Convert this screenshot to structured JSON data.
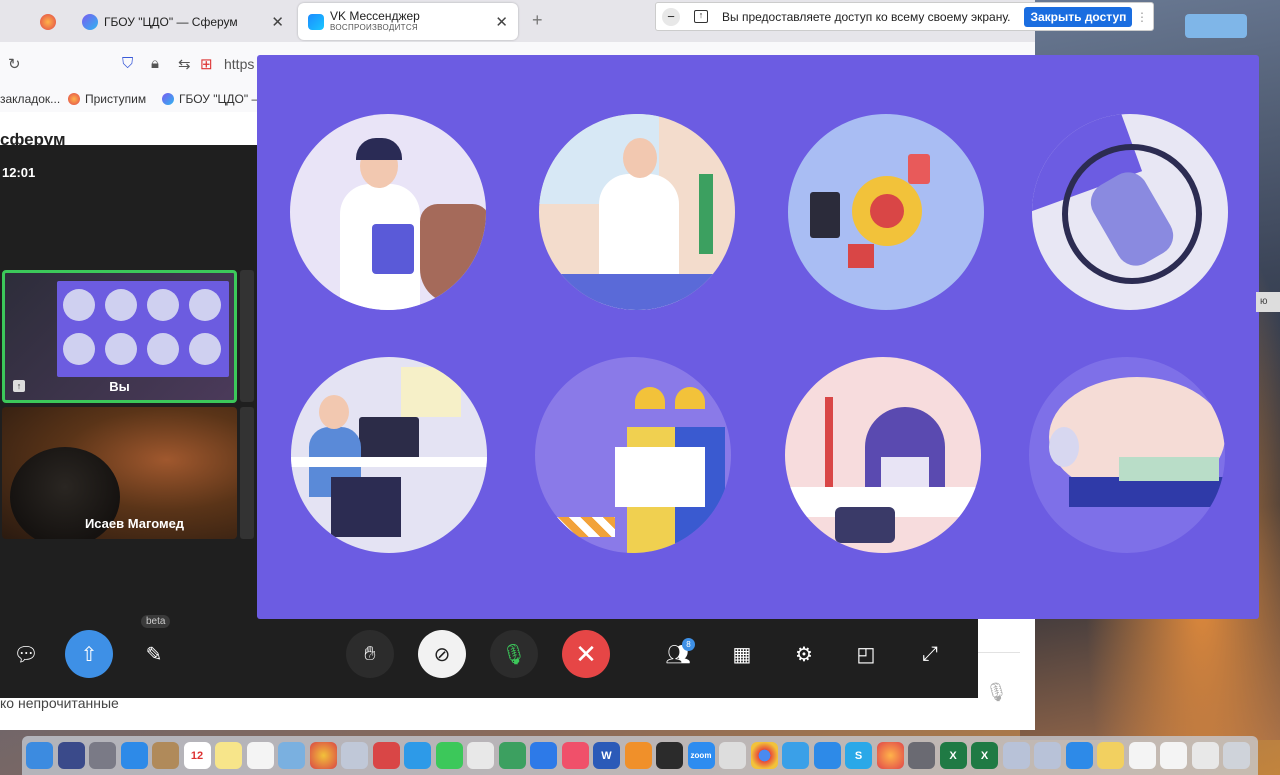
{
  "tabs": [
    {
      "title": ""
    },
    {
      "title": "ГБОУ \"ЦДО\" — Сферум"
    },
    {
      "title": "VK Мессенджер",
      "subtitle": "ВОСПРОИЗВОДИТСЯ"
    }
  ],
  "address": {
    "text": "https"
  },
  "bookmarks": [
    "закладок...",
    "Приступим",
    "ГБОУ \"ЦДО\" —"
  ],
  "app": {
    "title": "сферум",
    "filter_label": "ко непрочитанные"
  },
  "call": {
    "time": "12:01",
    "tiles": [
      {
        "label": "Вы"
      },
      {
        "label": "Исаев Магомед"
      }
    ],
    "participants_count": "8",
    "beta_label": "beta"
  },
  "share_notice": {
    "text": "Вы предоставляете доступ ко всему своему экрану.",
    "stop_button": "Закрыть доступ"
  },
  "side_edge_text": "ю",
  "dock": {
    "calendar_date": "12",
    "zoom_label": "zoom"
  },
  "colors": {
    "share_background": "#6c5ce2",
    "accent": "#3e90e6",
    "end_call": "#e64646",
    "active_tile_border": "#3cc85a"
  }
}
